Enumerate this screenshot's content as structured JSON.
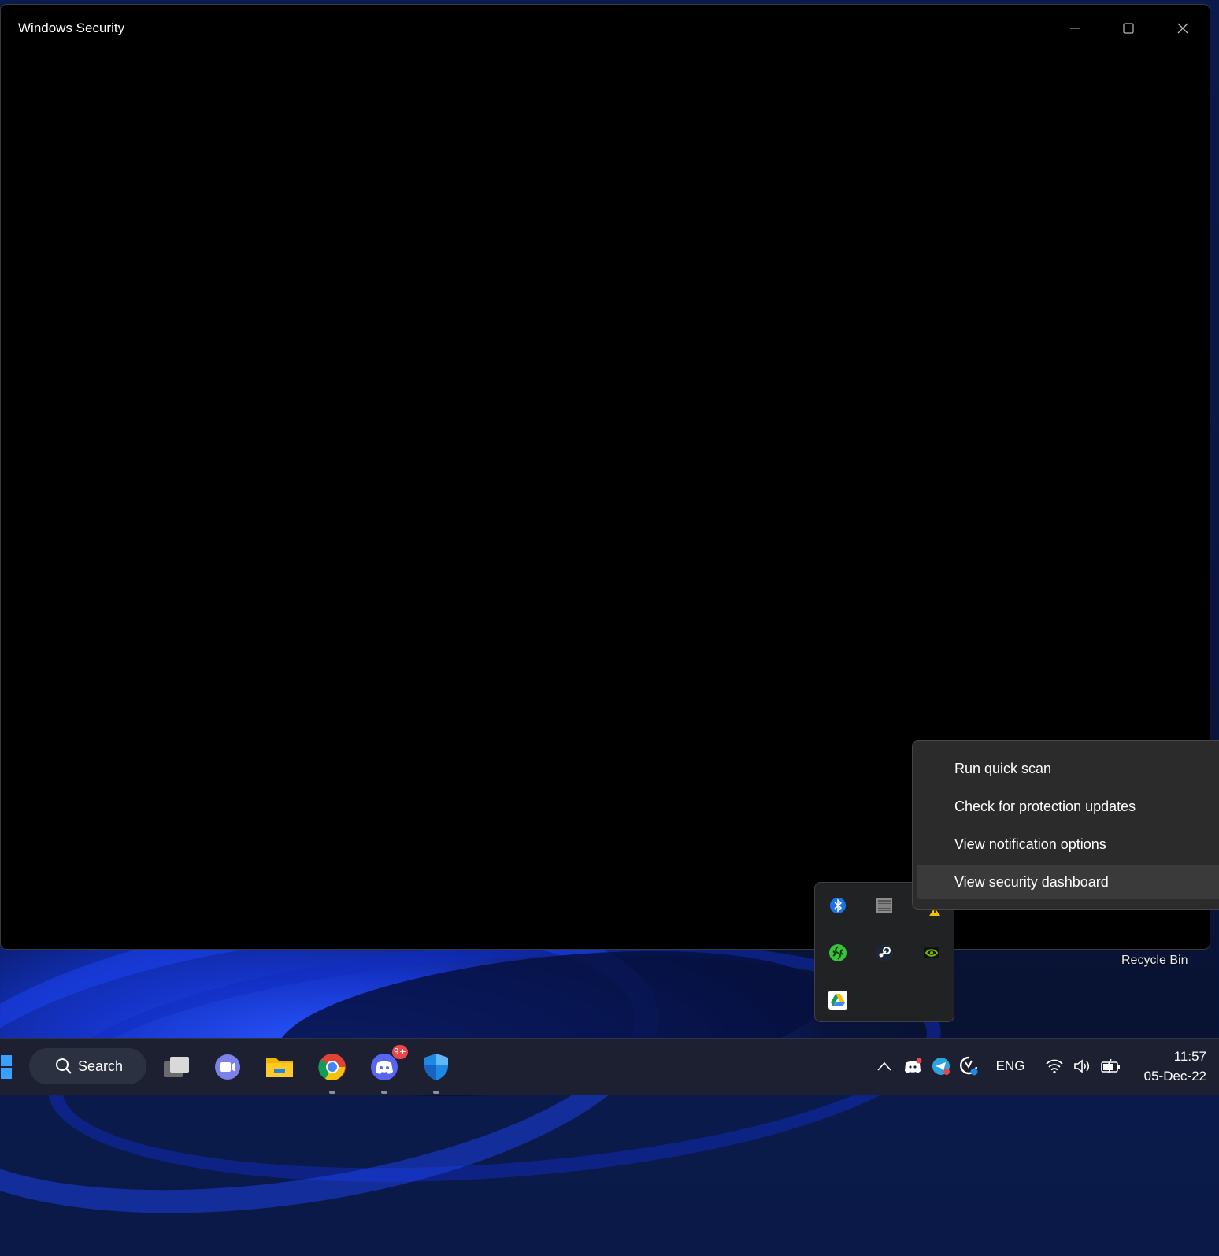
{
  "window": {
    "title": "Windows Security",
    "controls": {
      "minimize": "minimize-icon",
      "maximize": "maximize-icon",
      "close": "close-icon"
    }
  },
  "desktop": {
    "recycle_bin_label": "Recycle Bin"
  },
  "context_menu": {
    "items": [
      {
        "label": "Run quick scan"
      },
      {
        "label": "Check for protection updates"
      },
      {
        "label": "View notification options"
      },
      {
        "label": "View security dashboard",
        "highlighted": true
      }
    ]
  },
  "tray_overflow": {
    "icons": [
      "bluetooth-icon",
      "network-adapter-icon",
      "warning-icon",
      "razer-icon",
      "steam-icon",
      "nvidia-icon",
      "google-drive-icon"
    ]
  },
  "taskbar": {
    "search_label": "Search",
    "apps": [
      {
        "name": "task-view",
        "icon": "task-view-icon"
      },
      {
        "name": "teams",
        "icon": "teams-icon"
      },
      {
        "name": "file-explorer",
        "icon": "folder-icon"
      },
      {
        "name": "chrome",
        "icon": "chrome-icon"
      },
      {
        "name": "discord",
        "icon": "discord-icon",
        "badge": "9+"
      },
      {
        "name": "windows-security",
        "icon": "shield-icon"
      }
    ],
    "system_tray": {
      "language": "ENG",
      "time": "11:57",
      "date": "05-Dec-22"
    }
  },
  "colors": {
    "accent": "#0067c0",
    "taskbar_bg": "#1c2030",
    "menu_bg": "#2b2b2b",
    "menu_hover": "#3a3a3a",
    "badge": "#e5484d"
  }
}
